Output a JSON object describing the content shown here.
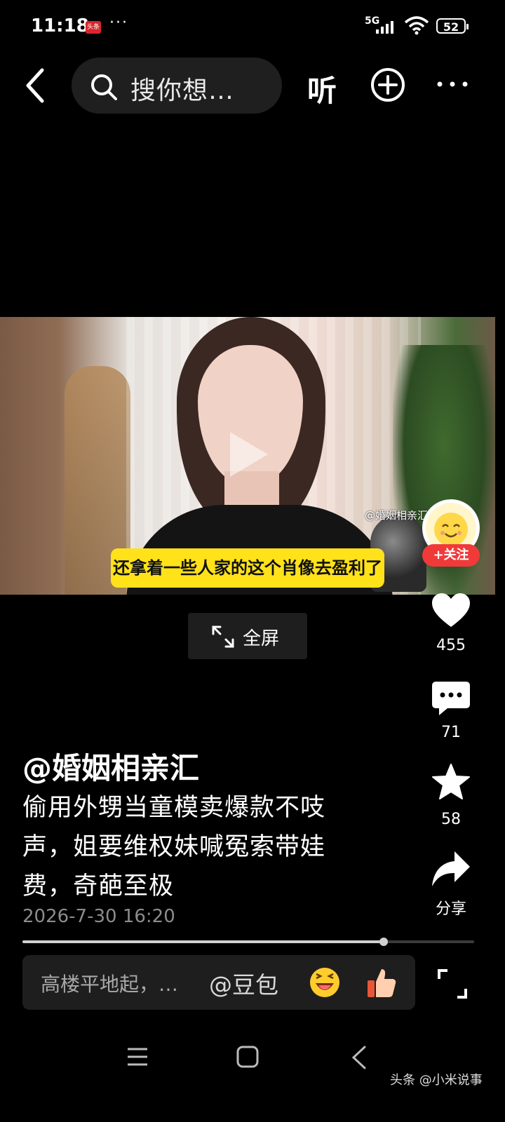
{
  "status_bar": {
    "time": "11:18",
    "app_badge": "头条",
    "more_dots": "···",
    "network": "5G",
    "battery": "52"
  },
  "top_bar": {
    "search_placeholder": "搜你想…",
    "listen_label": "听"
  },
  "video": {
    "watermark": "@婚姻相亲汇",
    "subtitle": "还拿着一些人家的这个肖像去盈利了",
    "fullscreen_label": "全屏"
  },
  "follow": {
    "label": "+关注"
  },
  "actions": {
    "likes": "455",
    "comments": "71",
    "favorites": "58",
    "share_label": "分享"
  },
  "post": {
    "author": "@婚姻相亲汇",
    "title": "偷用外甥当童模卖爆款不吱声，姐要维权妹喊冤索带娃费，奇葩至极",
    "date": "2026-7-30 16:20",
    "progress": 0.8
  },
  "comment_bar": {
    "placeholder": "高楼平地起，…",
    "mention": "@豆包"
  },
  "footer_watermark": "头条 @小米说事",
  "icons": {
    "back": "back-chevron-icon",
    "search": "search-icon",
    "add": "plus-circle-icon",
    "more": "more-dots-icon",
    "like": "heart-icon",
    "comment": "comment-bubble-icon",
    "favorite": "star-icon",
    "share": "share-arrow-icon"
  },
  "colors": {
    "background": "#000000",
    "subtitle_bg": "#ffe21a",
    "follow_bg": "#f03a3a",
    "pill_bg": "#1e1e1e"
  }
}
